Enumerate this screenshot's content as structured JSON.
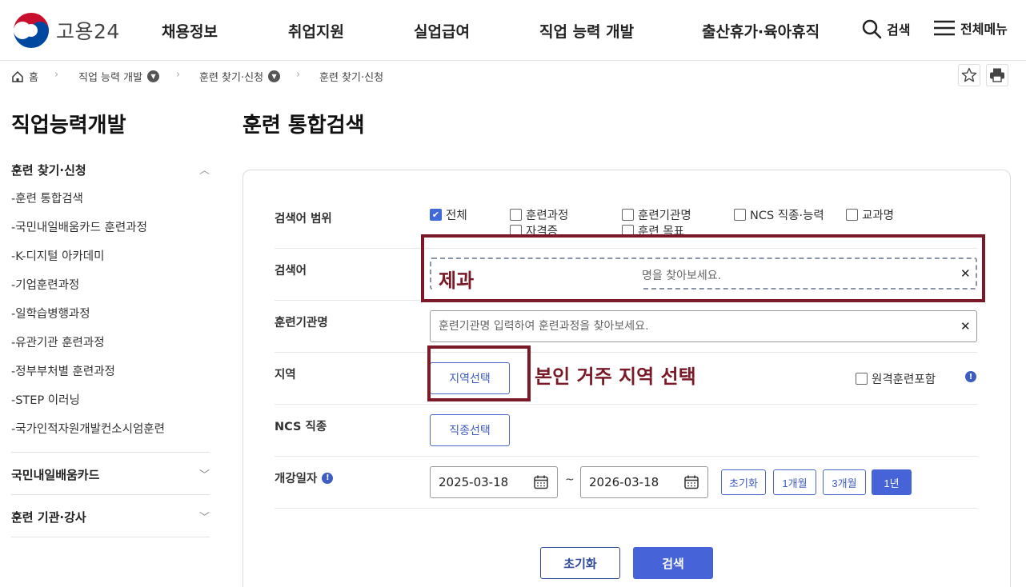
{
  "header": {
    "logo_text": "고용24",
    "nav": [
      "채용정보",
      "취업지원",
      "실업급여",
      "직업 능력 개발",
      "출산휴가·육아휴직"
    ],
    "search_label": "검색",
    "menu_label": "전체메뉴"
  },
  "breadcrumb": {
    "home": "홈",
    "level1": "직업 능력 개발",
    "level2": "훈련 찾기·신청",
    "level3": "훈련 찾기·신청"
  },
  "sidebar": {
    "title": "직업능력개발",
    "section1": "훈련 찾기·신청",
    "items": [
      "-훈련 통합검색",
      "-국민내일배움카드 훈련과정",
      "-K-디지털 아카데미",
      "-기업훈련과정",
      "-일학습병행과정",
      "-유관기관 훈련과정",
      "-정부부처별 훈련과정",
      "-STEP 이러닝",
      "-국가인적자원개발컨소시엄훈련"
    ],
    "section2": "국민내일배움카드",
    "section3": "훈련 기관·강사"
  },
  "main": {
    "title": "훈련 통합검색",
    "scope": {
      "label": "검색어 범위",
      "options": [
        "전체",
        "훈련과정",
        "훈련기관명",
        "NCS 직종·능력",
        "교과명",
        "자격증",
        "훈련 목표"
      ]
    },
    "keyword": {
      "label": "검색어",
      "placeholder": "명을 찾아보세요.",
      "value": "제과"
    },
    "institution": {
      "label": "훈련기관명",
      "placeholder": "훈련기관명 입력하여 훈련과정을 찾아보세요."
    },
    "region": {
      "label": "지역",
      "button": "지역선택",
      "remote": "원격훈련포함"
    },
    "ncs": {
      "label": "NCS 직종",
      "button": "직종선택"
    },
    "date": {
      "label": "개강일자",
      "start": "2025-03-18",
      "end": "2026-03-18",
      "separator": "~",
      "ranges": [
        "초기화",
        "1개월",
        "3개월",
        "1년"
      ]
    },
    "actions": {
      "reset": "초기화",
      "search": "검색"
    }
  },
  "annotations": {
    "keyword_note": "제과",
    "region_note": "본인 거주 지역 선택"
  },
  "colors": {
    "accent": "#4763d8",
    "annotation": "#7a1a28"
  }
}
